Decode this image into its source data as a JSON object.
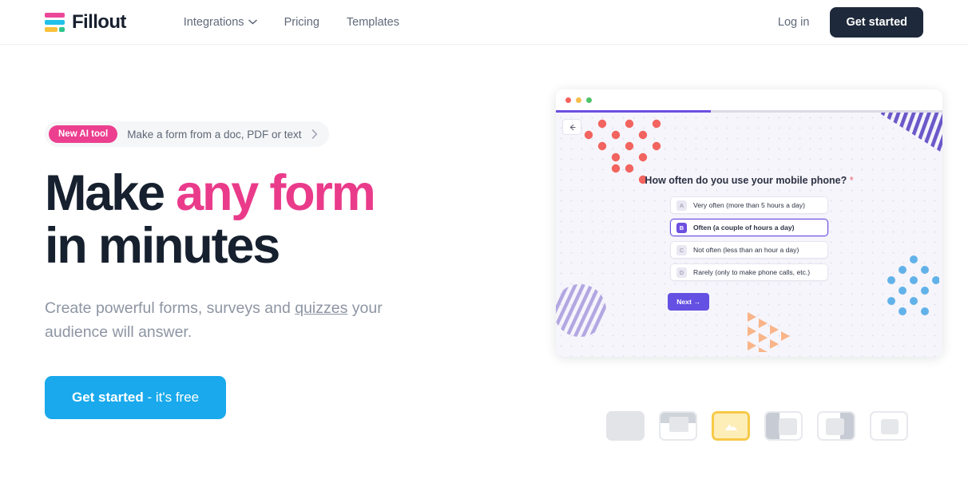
{
  "navbar": {
    "brand_name": "Fillout",
    "logo_icon": "fillout-bars-logo",
    "links": [
      {
        "label": "Integrations",
        "has_chevron": true,
        "icon": "chevron-down-icon"
      },
      {
        "label": "Pricing",
        "has_chevron": false
      },
      {
        "label": "Templates",
        "has_chevron": false
      }
    ],
    "login_label": "Log in",
    "cta_label": "Get started"
  },
  "hero": {
    "badge": {
      "pill_label": "New AI tool",
      "text": "Make a form from a doc, PDF or text",
      "chevron_icon": "chevron-right-icon"
    },
    "headline_line1_prefix": "Make ",
    "headline_accent": "any form",
    "headline_line2": "in minutes",
    "subhead_prefix": "Create powerful forms, surveys and ",
    "subhead_link": "quizzes",
    "subhead_suffix": " your audience will answer.",
    "cta_bold": "Get started",
    "cta_regular": " - it's free"
  },
  "preview": {
    "window_dots": [
      "red",
      "yellow",
      "green"
    ],
    "progress_percent": 40,
    "back_icon": "arrow-left-icon",
    "question": "How often do you use your mobile phone?",
    "required_marker": "*",
    "options": [
      {
        "key": "A",
        "label": "Very often (more than 5 hours a day)",
        "selected": false
      },
      {
        "key": "B",
        "label": "Often (a couple of hours a day)",
        "selected": true
      },
      {
        "key": "C",
        "label": "Not often (less than an hour a day)",
        "selected": false
      },
      {
        "key": "D",
        "label": "Rarely (only to make phone calls, etc.)",
        "selected": false
      }
    ],
    "next_label": "Next →",
    "decorations": [
      "red-dot-cluster",
      "blue-dot-cluster",
      "purple-striped-triangle",
      "purple-striped-circle",
      "orange-triangle-cluster"
    ]
  },
  "thumbnails": {
    "items": [
      {
        "name": "layout-plain",
        "icon": "blank-layout-icon",
        "selected": false
      },
      {
        "name": "layout-top-banner",
        "icon": "top-banner-layout-icon",
        "selected": false
      },
      {
        "name": "layout-full-image",
        "icon": "image-layout-icon",
        "selected": true
      },
      {
        "name": "layout-left-panel",
        "icon": "left-panel-layout-icon",
        "selected": false
      },
      {
        "name": "layout-right-panel",
        "icon": "right-panel-layout-icon",
        "selected": false
      },
      {
        "name": "layout-card",
        "icon": "card-layout-icon",
        "selected": false
      }
    ]
  },
  "colors": {
    "accent_pink": "#ea3b8b",
    "badge_pink": "#ec3f8f",
    "cta_blue": "#19a9ec",
    "dark": "#1e293b",
    "purple": "#6c4fe0",
    "thumb_active": "#f7c948"
  }
}
